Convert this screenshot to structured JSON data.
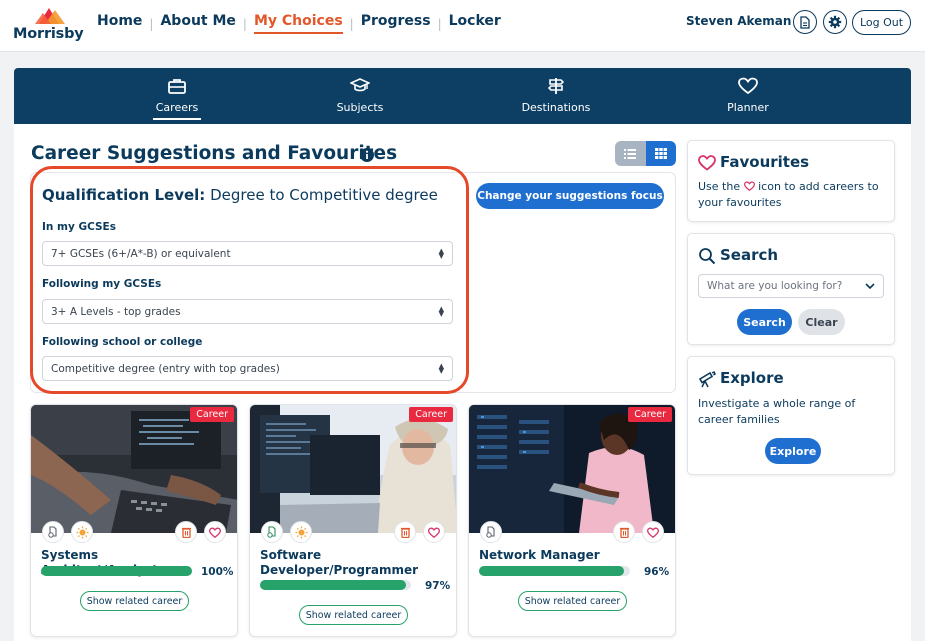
{
  "header": {
    "logo_text": "Morrisby",
    "nav": [
      {
        "label": "Home",
        "active": false
      },
      {
        "label": "About Me",
        "active": false
      },
      {
        "label": "My Choices",
        "active": true
      },
      {
        "label": "Progress",
        "active": false
      },
      {
        "label": "Locker",
        "active": false
      }
    ],
    "user_name": "Steven Akeman",
    "logout_label": "Log Out"
  },
  "section_nav": [
    {
      "label": "Careers",
      "icon": "briefcase-icon",
      "active": true
    },
    {
      "label": "Subjects",
      "icon": "graduation-cap-icon",
      "active": false
    },
    {
      "label": "Destinations",
      "icon": "signpost-icon",
      "active": false
    },
    {
      "label": "Planner",
      "icon": "heart-icon",
      "active": false
    }
  ],
  "main": {
    "title": "Career Suggestions and Favourites",
    "qualification": {
      "label": "Qualification Level:",
      "value": "Degree to Competitive degree",
      "focus_button": "Change your suggestions focus",
      "fields": [
        {
          "label": "In my GCSEs",
          "value": "7+ GCSEs (6+/A*-B) or equivalent"
        },
        {
          "label": "Following my GCSEs",
          "value": "3+ A Levels - top grades"
        },
        {
          "label": "Following school or college",
          "value": "Competitive degree (entry with top grades)"
        }
      ]
    },
    "careers": [
      {
        "tag": "Career",
        "name": "Systems Architect/Analyst",
        "match": 100,
        "match_label": "100%",
        "related_label": "Show related career"
      },
      {
        "tag": "Career",
        "name": "Software Developer/Programmer",
        "match": 97,
        "match_label": "97%",
        "related_label": "Show related career"
      },
      {
        "tag": "Career",
        "name": "Network Manager",
        "match": 96,
        "match_label": "96%",
        "related_label": "Show related career"
      }
    ]
  },
  "sidebar": {
    "favourites": {
      "title": "Favourites",
      "text_before": "Use the",
      "text_after": "icon to add careers to your favourites"
    },
    "search": {
      "title": "Search",
      "placeholder": "What are you looking for?",
      "search_label": "Search",
      "clear_label": "Clear"
    },
    "explore": {
      "title": "Explore",
      "text": "Investigate a whole range of career families",
      "button": "Explore"
    }
  },
  "colors": {
    "brand": "#0c3f63",
    "accent": "#e3582a",
    "primary_button": "#1f6fd0",
    "match_bar": "#27a26a",
    "career_tag": "#e8293f"
  }
}
